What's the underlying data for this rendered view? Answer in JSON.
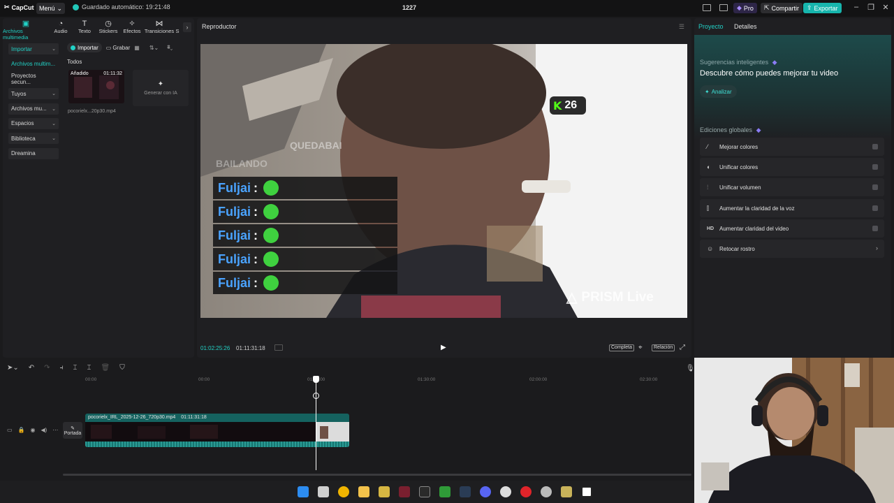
{
  "app": {
    "name": "CapCut",
    "menu_label": "Menú",
    "autosave_text": "Guardado automático: 19:21:48",
    "project_title": "1227",
    "pro_label": "Pro",
    "share_label": "Compartir",
    "export_label": "Exportar"
  },
  "colors": {
    "accent": "#21d1c6",
    "export_bg": "#17b5ad",
    "panel_bg": "#1f1f22"
  },
  "tool_tabs": [
    {
      "label": "Archivos multimedia",
      "icon": "media-icon"
    },
    {
      "label": "Audio",
      "icon": "audio-icon"
    },
    {
      "label": "Texto",
      "icon": "text-icon"
    },
    {
      "label": "Stickers",
      "icon": "sticker-icon"
    },
    {
      "label": "Efectos",
      "icon": "effects-icon"
    },
    {
      "label": "Transiciones",
      "icon": "transitions-icon"
    },
    {
      "label": "S",
      "icon": "more-icon"
    }
  ],
  "side_nav": [
    {
      "label": "Importar",
      "chevron": "⌄"
    },
    {
      "label": "Archivos multim...",
      "chevron": ""
    },
    {
      "label": "Proyectos secun...",
      "chevron": ""
    },
    {
      "label": "Tuyos",
      "chevron": "⌄"
    },
    {
      "label": "Archivos mu...",
      "chevron": "⌄"
    },
    {
      "label": "Espacios",
      "chevron": "⌄"
    },
    {
      "label": "Biblioteca",
      "chevron": "⌄"
    },
    {
      "label": "Dreamina",
      "chevron": ""
    }
  ],
  "media": {
    "import_label": "Importar",
    "record_label": "Grabar",
    "filter_label": "Todos",
    "thumb_added": "Añadido",
    "thumb_duration": "01:11:32",
    "thumb_name": "pocorielx...20p30.mp4",
    "generate_label": "Generar con IA"
  },
  "player": {
    "title": "Reproductor",
    "current_time": "01:02:25:26",
    "total_time": "01:11:31:18",
    "full_label": "Completa",
    "ratio_label": "Relación",
    "overlay": {
      "kick_count": "26",
      "banner_text": "QUEDABAI",
      "banner_text2": "BAILANDO",
      "chat_name": "Fuljai",
      "chat_sep": ":",
      "watermark": "PRISM Live"
    }
  },
  "right_panel": {
    "tab_project": "Proyecto",
    "tab_details": "Detalles",
    "suggest_label": "Sugerencias inteligentes",
    "headline": "Descubre cómo puedes mejorar tu video",
    "analyze_label": "Analizar",
    "global_label": "Ediciones globales",
    "items": [
      {
        "label": "Mejorar colores",
        "icon": "wand-icon",
        "type": "toggle"
      },
      {
        "label": "Unificar colores",
        "icon": "palette-icon",
        "type": "toggle"
      },
      {
        "label": "Unificar volumen",
        "icon": "volume-bars-icon",
        "type": "toggle"
      },
      {
        "label": "Aumentar la claridad de la voz",
        "icon": "voice-icon",
        "type": "toggle"
      },
      {
        "label": "Aumentar claridad del video",
        "icon": "hd-icon",
        "type": "toggle"
      },
      {
        "label": "Retocar rostro",
        "icon": "face-icon",
        "type": "arrow"
      }
    ]
  },
  "timeline": {
    "ticks": [
      "00:00",
      "00:00",
      "01:00:00",
      "01:30:00",
      "02:00:00",
      "02:30:00"
    ],
    "cover_label": "Portada",
    "clip_label": "pocorielx_IRL_2025-12-26_720p30.mp4",
    "clip_duration": "01:11:31:18"
  }
}
